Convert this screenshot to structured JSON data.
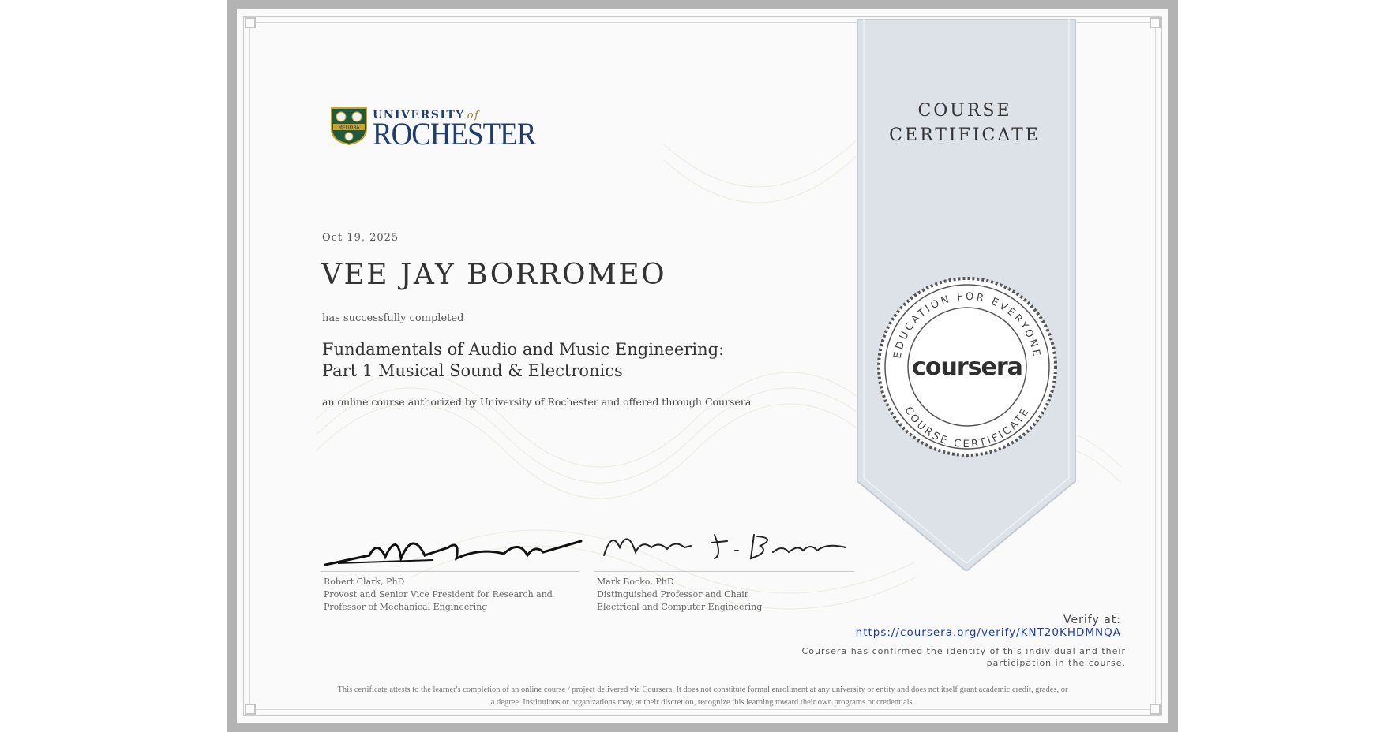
{
  "issuer": {
    "university_line": "UNIVERSITY",
    "university_of": "of",
    "university_name": "ROCHESTER",
    "seal_motto": "MELIORA"
  },
  "certificate": {
    "ribbon_title_1": "COURSE",
    "ribbon_title_2": "CERTIFICATE",
    "date": "Oct 19, 2025",
    "recipient": "VEE JAY BORROMEO",
    "completed_text": "has successfully completed",
    "course_title_line1": "Fundamentals of Audio and Music Engineering:",
    "course_title_line2": "Part 1 Musical Sound & Electronics",
    "authorized_text": "an online course authorized by University of Rochester and offered through Coursera"
  },
  "seal": {
    "brand": "coursera",
    "ring_top": "EDUCATION FOR EVERYONE",
    "ring_bottom": "COURSE CERTIFICATE"
  },
  "signatories": [
    {
      "name": "Robert Clark, PhD",
      "title_line1": "Provost and Senior Vice President for Research and",
      "title_line2": "Professor of Mechanical Engineering"
    },
    {
      "name": "Mark Bocko, PhD",
      "title_line1": "Distinguished Professor and Chair",
      "title_line2": "Electrical and Computer Engineering"
    }
  ],
  "verify": {
    "label": "Verify at:",
    "url": "https://coursera.org/verify/KNT20KHDMNQA",
    "identity_line1": "Coursera has confirmed the identity of this individual and their",
    "identity_line2": "participation in the course."
  },
  "disclaimer": {
    "line1": "This certificate attests to the learner's completion of an online course / project delivered via Coursera. It does not constitute formal enrollment at any university or entity and does not itself grant academic credit, grades, or",
    "line2": "a degree. Institutions or organizations may, at their discretion, recognize this learning toward their own programs or credentials."
  },
  "colors": {
    "frame_gray": "#b3b3b3",
    "ribbon": "#dde2e9",
    "rochester_blue": "#1f3d6e",
    "rochester_gold": "#c9a227",
    "link_blue": "#1f3aa8"
  }
}
